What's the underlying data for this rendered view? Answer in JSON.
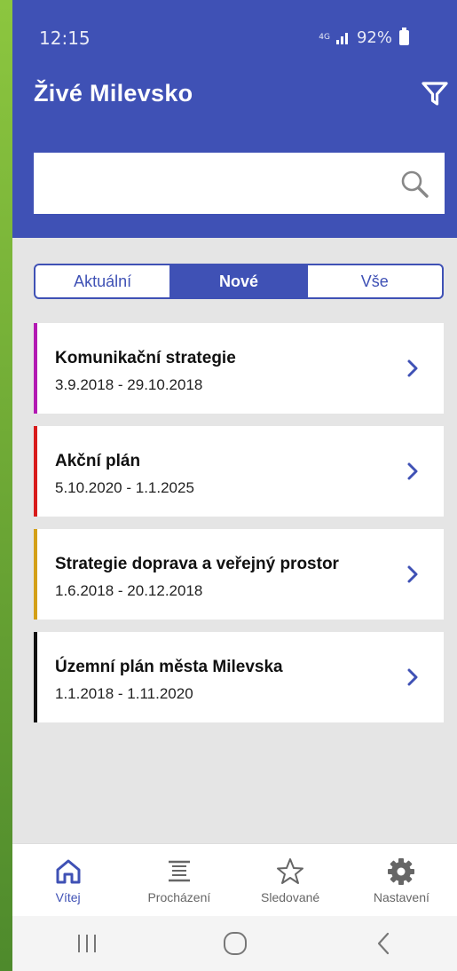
{
  "status_bar": {
    "time": "12:15",
    "network": "4G",
    "battery": "92%"
  },
  "app": {
    "title": "Živé Milevsko"
  },
  "search": {
    "placeholder": "",
    "value": ""
  },
  "tabs": [
    {
      "label": "Aktuální",
      "active": false
    },
    {
      "label": "Nové",
      "active": true
    },
    {
      "label": "Vše",
      "active": false
    }
  ],
  "items": [
    {
      "title": "Komunikační strategie",
      "dates": "3.9.2018 - 29.10.2018",
      "color": "#b31ab3"
    },
    {
      "title": "Akční plán",
      "dates": "5.10.2020 - 1.1.2025",
      "color": "#d81b1b"
    },
    {
      "title": "Strategie doprava a veřejný prostor",
      "dates": "1.6.2018 - 20.12.2018",
      "color": "#d4a017"
    },
    {
      "title": "Územní plán města Milevska",
      "dates": "1.1.2018 - 1.11.2020",
      "color": "#111111"
    }
  ],
  "bottom_nav": [
    {
      "label": "Vítej",
      "icon": "home-icon",
      "active": true
    },
    {
      "label": "Procházení",
      "icon": "list-icon",
      "active": false
    },
    {
      "label": "Sledované",
      "icon": "star-icon",
      "active": false
    },
    {
      "label": "Nastavení",
      "icon": "gear-icon",
      "active": false
    }
  ],
  "colors": {
    "primary": "#3f51b5",
    "background": "#e5e5e5"
  }
}
